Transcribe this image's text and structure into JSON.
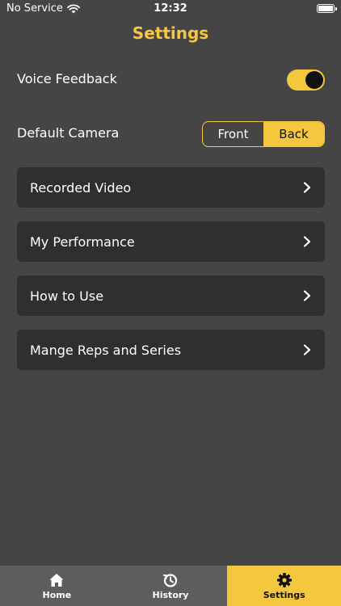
{
  "status_bar": {
    "carrier": "No Service",
    "time": "12:32"
  },
  "header": {
    "title": "Settings"
  },
  "settings": {
    "voice_feedback": {
      "label": "Voice Feedback",
      "enabled": true
    },
    "default_camera": {
      "label": "Default Camera",
      "options": [
        "Front",
        "Back"
      ],
      "selected": "Back"
    }
  },
  "menu": {
    "items": [
      {
        "label": "Recorded Video"
      },
      {
        "label": "My Performance"
      },
      {
        "label": "How to Use"
      },
      {
        "label": "Mange Reps and Series"
      }
    ]
  },
  "tab_bar": {
    "tabs": [
      {
        "label": "Home",
        "icon": "home-icon"
      },
      {
        "label": "History",
        "icon": "history-icon"
      },
      {
        "label": "Settings",
        "icon": "gear-icon"
      }
    ],
    "active": "Settings"
  },
  "colors": {
    "accent": "#f5c73e",
    "background": "#454545",
    "card": "#2f2f2f",
    "tab_bar": "#5d5d5d"
  }
}
